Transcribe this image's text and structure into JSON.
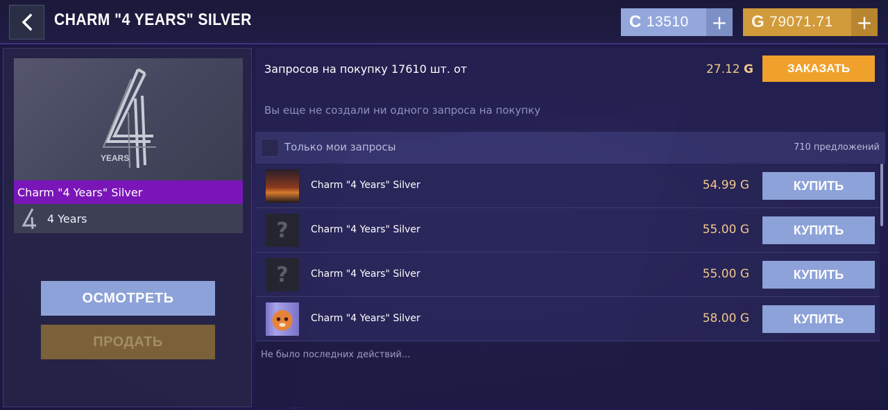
{
  "header": {
    "title": "CHARM \"4 YEARS\" SILVER",
    "silver_currency": {
      "icon": "silver-coin-icon",
      "amount": "13510",
      "plus": "+"
    },
    "gold_currency": {
      "icon": "gold-coin-icon",
      "amount": "79071.71",
      "plus": "+"
    }
  },
  "item": {
    "name": "Charm \"4 Years\" Silver",
    "collection": "4 Years",
    "name_bar_color": "#7a15b8"
  },
  "actions": {
    "inspect_label": "ОСМОТРЕТЬ",
    "sell_label": "ПРОДАТЬ"
  },
  "orders": {
    "requests_text": "Запросов на покупку 17610 шт. от",
    "request_price": "27.12",
    "currency_symbol": "G",
    "order_label": "ЗАКАЗАТЬ",
    "no_requests_text": "Вы еще не создали ни одного запроса на покупку"
  },
  "filter": {
    "only_mine_label": "Только мои запросы",
    "offers_count": "710 предложений"
  },
  "listings": [
    {
      "name": "Charm \"4 Years\" Silver",
      "price": "54.99",
      "thumb": "sunset-sticker",
      "buy_label": "КУПИТЬ"
    },
    {
      "name": "Charm \"4 Years\" Silver",
      "price": "55.00",
      "thumb": "unknown",
      "buy_label": "КУПИТЬ"
    },
    {
      "name": "Charm \"4 Years\" Silver",
      "price": "55.00",
      "thumb": "unknown",
      "buy_label": "КУПИТЬ"
    },
    {
      "name": "Charm \"4 Years\" Silver",
      "price": "58.00",
      "thumb": "tiger-sticker",
      "buy_label": "КУПИТЬ"
    }
  ],
  "history": {
    "text": "Не было последних действий..."
  },
  "colors": {
    "accent_blue": "#8da2d8",
    "accent_gold": "#f0a12c",
    "price_gold": "#f2c88a"
  }
}
